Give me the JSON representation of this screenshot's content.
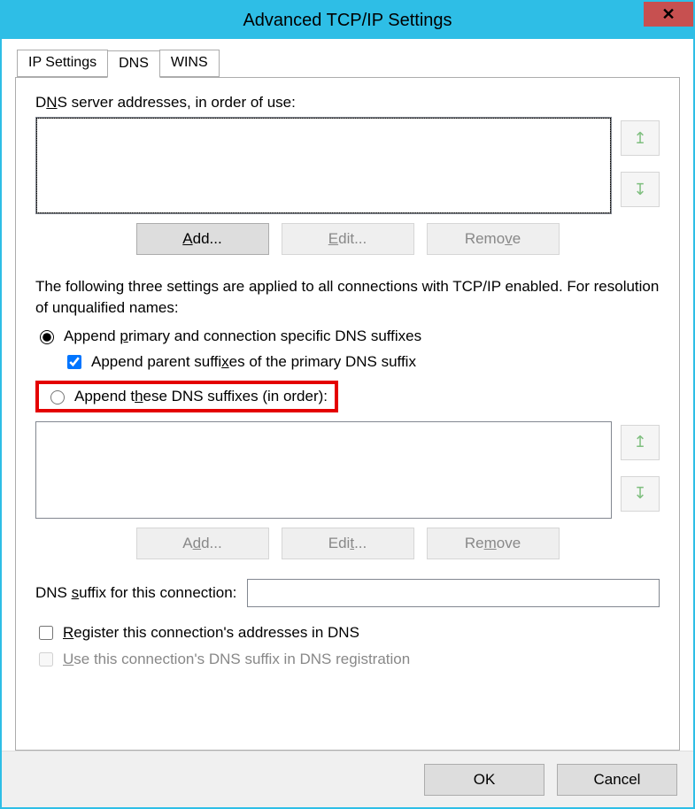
{
  "title": "Advanced TCP/IP Settings",
  "tabs": {
    "ip": "IP Settings",
    "dns": "DNS",
    "wins": "WINS"
  },
  "dns": {
    "servers_label_pre": "D",
    "servers_label_u": "N",
    "servers_label_post": "S server addresses, in order of use:",
    "add_u": "A",
    "add_post": "dd...",
    "edit_u": "E",
    "edit_post": "dit...",
    "remove_pre": "Remo",
    "remove_u": "v",
    "remove_post": "e",
    "explain": "The following three settings are applied to all connections with TCP/IP enabled. For resolution of unqualified names:",
    "radio1_pre": "Append ",
    "radio1_u": "p",
    "radio1_post": "rimary and connection specific DNS suffixes",
    "check1_pre": "Append parent suffi",
    "check1_u": "x",
    "check1_post": "es of the primary DNS suffix",
    "radio2_pre": "Append t",
    "radio2_u": "h",
    "radio2_post": "ese DNS suffixes (in order):",
    "add2_pre": "A",
    "add2_u": "d",
    "add2_post": "d...",
    "edit2_pre": "Edi",
    "edit2_u": "t",
    "edit2_post": "...",
    "remove2_pre": "Re",
    "remove2_u": "m",
    "remove2_post": "ove",
    "suffix_label_pre": "DNS ",
    "suffix_label_u": "s",
    "suffix_label_post": "uffix for this connection:",
    "reg_pre": "",
    "reg_u": "R",
    "reg_post": "egister this connection's addresses in DNS",
    "use_pre": "",
    "use_u": "U",
    "use_post": "se this connection's DNS suffix in DNS registration"
  },
  "footer": {
    "ok": "OK",
    "cancel": "Cancel"
  }
}
